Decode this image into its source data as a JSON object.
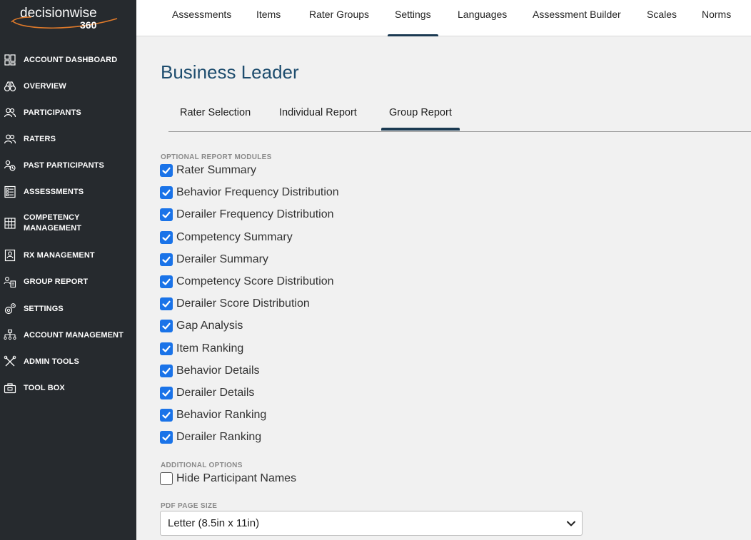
{
  "brand": {
    "name": "decisionwise",
    "sub": "360"
  },
  "topnav": {
    "tabs": [
      "Assessments",
      "Items",
      "Rater Groups",
      "Settings",
      "Languages",
      "Assessment Builder",
      "Scales",
      "Norms"
    ],
    "active": "Settings"
  },
  "sidebar": {
    "items": [
      {
        "label": "ACCOUNT DASHBOARD",
        "icon": "dashboard-icon"
      },
      {
        "label": "OVERVIEW",
        "icon": "binoculars-icon"
      },
      {
        "label": "PARTICIPANTS",
        "icon": "people-icon"
      },
      {
        "label": "RATERS",
        "icon": "people-icon"
      },
      {
        "label": "PAST PARTICIPANTS",
        "icon": "people-history-icon"
      },
      {
        "label": "ASSESSMENTS",
        "icon": "checklist-icon"
      },
      {
        "label": "COMPETENCY\nMANAGEMENT",
        "icon": "grid-icon"
      },
      {
        "label": "RX MANAGEMENT",
        "icon": "person-report-icon"
      },
      {
        "label": "GROUP REPORT",
        "icon": "group-report-icon"
      },
      {
        "label": "SETTINGS",
        "icon": "gears-icon"
      },
      {
        "label": "ACCOUNT MANAGEMENT",
        "icon": "org-chart-icon"
      },
      {
        "label": "ADMIN TOOLS",
        "icon": "tools-icon"
      },
      {
        "label": "TOOL BOX",
        "icon": "toolbox-icon"
      }
    ]
  },
  "page": {
    "title": "Business Leader",
    "subtabs": [
      "Rater Selection",
      "Individual Report",
      "Group Report"
    ],
    "active_subtab": "Group Report"
  },
  "modules": {
    "label": "OPTIONAL REPORT MODULES",
    "items": [
      {
        "label": "Rater Summary",
        "checked": true
      },
      {
        "label": "Behavior Frequency Distribution",
        "checked": true
      },
      {
        "label": "Derailer Frequency Distribution",
        "checked": true
      },
      {
        "label": "Competency Summary",
        "checked": true
      },
      {
        "label": "Derailer Summary",
        "checked": true
      },
      {
        "label": "Competency Score Distribution",
        "checked": true
      },
      {
        "label": "Derailer Score Distribution",
        "checked": true
      },
      {
        "label": "Gap Analysis",
        "checked": true
      },
      {
        "label": "Item Ranking",
        "checked": true
      },
      {
        "label": "Behavior Details",
        "checked": true
      },
      {
        "label": "Derailer Details",
        "checked": true
      },
      {
        "label": "Behavior Ranking",
        "checked": true
      },
      {
        "label": "Derailer Ranking",
        "checked": true
      }
    ]
  },
  "additional": {
    "label": "ADDITIONAL OPTIONS",
    "items": [
      {
        "label": "Hide Participant Names",
        "checked": false
      }
    ]
  },
  "pdf": {
    "label": "PDF PAGE SIZE",
    "value": "Letter (8.5in x 11in)"
  },
  "colors": {
    "sidebar": "#262a2e",
    "accent": "#1b3a52",
    "checkbox": "#1a73e8",
    "title": "#1e4d6e",
    "logo_swoosh": "#e07a2a"
  }
}
